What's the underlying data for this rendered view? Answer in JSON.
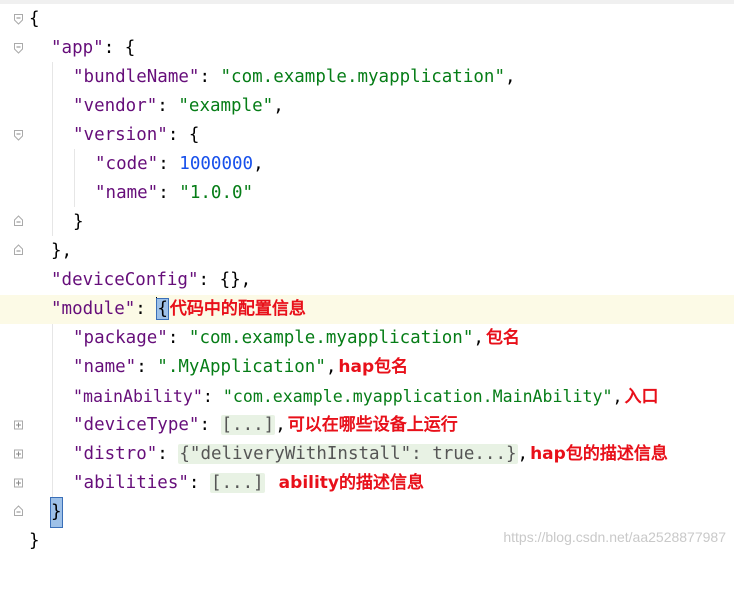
{
  "editor": {
    "lines": {
      "l1": {
        "open": "{"
      },
      "l2": {
        "key": "\"app\"",
        "rest": ": {"
      },
      "l3": {
        "key": "\"bundleName\"",
        "sep": ": ",
        "val": "\"com.example.myapplication\"",
        "end": ","
      },
      "l4": {
        "key": "\"vendor\"",
        "sep": ": ",
        "val": "\"example\"",
        "end": ","
      },
      "l5": {
        "key": "\"version\"",
        "rest": ": {"
      },
      "l6": {
        "key": "\"code\"",
        "sep": ": ",
        "val": "1000000",
        "end": ","
      },
      "l7": {
        "key": "\"name\"",
        "sep": ": ",
        "val": "\"1.0.0\""
      },
      "l8": {
        "close": "}"
      },
      "l9": {
        "close": "},"
      },
      "l10": {
        "key": "\"deviceConfig\"",
        "rest": ": {},"
      },
      "l11": {
        "key": "\"module\"",
        "sep": ": ",
        "brace": "{",
        "note": "代码中的配置信息"
      },
      "l12": {
        "key": "\"package\"",
        "sep": ": ",
        "val": "\"com.example.myapplication\"",
        "end": ",",
        "note": "包名"
      },
      "l13": {
        "key": "\"name\"",
        "sep": ": ",
        "val": "\".MyApplication\"",
        "end": ",",
        "note": "hap包名"
      },
      "l14": {
        "key": "\"mainAbility\"",
        "sep": ": ",
        "val": "\"com.example.myapplication.MainAbility\"",
        "end": ",",
        "note": "入口"
      },
      "l15": {
        "key": "\"deviceType\"",
        "sep": ": ",
        "folded": "[...]",
        "end": ",",
        "note": "可以在哪些设备上运行"
      },
      "l16": {
        "key": "\"distro\"",
        "sep": ": ",
        "folded": "{\"deliveryWithInstall\": true...}",
        "end": ",",
        "note": "hap包的描述信息"
      },
      "l17": {
        "key": "\"abilities\"",
        "sep": ": ",
        "folded": "[...]",
        "note": "ability的描述信息"
      },
      "l18": {
        "close": "}"
      },
      "l19": {
        "close": "}"
      }
    }
  },
  "watermark": "https://blog.csdn.net/aa2528877987",
  "colors": {
    "key": "#660e7a",
    "string": "#067d17",
    "number": "#1750eb",
    "annotation": "#e8101a",
    "current_line": "#fcfae6"
  }
}
